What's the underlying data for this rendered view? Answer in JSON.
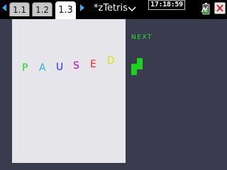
{
  "tabs": [
    {
      "label": "1.1"
    },
    {
      "label": "1.2"
    },
    {
      "label": "1.3",
      "active": true
    }
  ],
  "document": {
    "title": "*zTetris"
  },
  "clock": {
    "time": "17:18:59"
  },
  "game": {
    "status_letters": [
      "P",
      "A",
      "U",
      "S",
      "E",
      "D"
    ],
    "status_colors": [
      "#22d822",
      "#22b8d8",
      "#2a2aff",
      "#c800c8",
      "#ff2020",
      "#e0e000"
    ],
    "next_label": "NEXT",
    "next_piece_color": "#1ed31e",
    "next_piece_shape": "S"
  },
  "icons": {
    "tab_prev": "left-arrow-icon",
    "tab_next": "right-arrow-icon",
    "title_menu": "chevron-down-icon",
    "battery": "battery-icon",
    "close": "close-icon"
  }
}
